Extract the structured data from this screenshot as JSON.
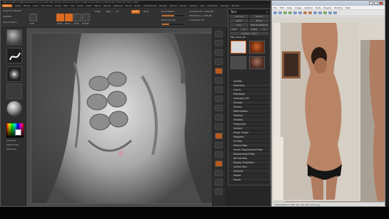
{
  "zbrush": {
    "title_bar": "ZBrush 4R6 [C:\\ZBrush\\Default Document]   ZBrush Document   Free Mem 8.8GB   Active Mem 1.1GB   Scratch Disk 48   Timer 0.006",
    "menu_items": [
      "Alpha",
      "Brush",
      "Color",
      "Document",
      "Draw",
      "Edit",
      "File",
      "Layer",
      "Light",
      "Macro",
      "Marker",
      "Material",
      "Movie",
      "Picker",
      "Preferences",
      "Render",
      "Stencil",
      "Stroke",
      "Texture",
      "Tool",
      "Transform",
      "Zplugin",
      "Zscript"
    ],
    "menu_highlight": "Menus",
    "tabs": {
      "edit": "Edit",
      "draw": "Draw",
      "move": "Move",
      "scale": "Scale",
      "rotate": "Rotate",
      "mrgb": "Mrgb",
      "rgb": "Rgb",
      "m": "M",
      "zadd": "Zadd",
      "zsub": "Zsub",
      "focal_shift": "Focal Shift 0",
      "draw_size": "Draw Size 64",
      "z_intensity": "Z Intensity 25",
      "active_points": "ActivePoints: 1.006 Mil",
      "total_points": "TotalPoints: 1.006 Mil"
    },
    "left_shelf": {
      "projection_master": "Projection Master",
      "lightbox": "LightBox",
      "quick_sketch": "Quick Sketch",
      "gradient": "Gradient",
      "switch_color": "SwitchColor",
      "alternate": "Alternate"
    },
    "right_shelf_labels": [
      "BPR",
      "SPix 3",
      "Scroll",
      "Zoom",
      "Actual",
      "AAHalf",
      "Persp",
      "Floor",
      "Local",
      "L.Sym",
      "Frame",
      "Move",
      "Scale",
      "Rotate",
      "PolyF",
      "Transp",
      "Solo",
      "Xpose"
    ]
  },
  "tool_panel": {
    "title": "Tool",
    "close": "×",
    "buttons_row1": [
      "Load Tool",
      "Save As"
    ],
    "buttons_row2": [
      "Import",
      "Export"
    ],
    "buttons_row3": [
      "Clone",
      "Make PolyMesh3D"
    ],
    "buttons_row4": [
      "GoZ",
      "All",
      "Visible",
      "R"
    ],
    "buttons_row5": [
      "Lightbox > Tools"
    ],
    "current_tool": "Man_Torso_02",
    "items": [
      "SubTool",
      "Geometry",
      "Layers",
      "FiberMesh",
      "Geometry HD",
      "Preview",
      "Surface",
      "Deformation",
      "Masking",
      "Visibility",
      "Polygroups",
      "Contact",
      "Morph Target",
      "Polypaint",
      "UV Map",
      "Texture Map",
      "Vector Displacement Map",
      "Displacement Map",
      "Normal Map",
      "Display Properties",
      "Unified Skin",
      "Initialize",
      "Import",
      "Export"
    ]
  },
  "viewer": {
    "menu_items": [
      "File",
      "Edit",
      "View",
      "Image",
      "Options",
      "Tools",
      "Plugins",
      "Window",
      "Help"
    ],
    "status": "1920x2880x24 BPP   38%   JPG   IMG_8412.jpg",
    "colors": {
      "title_active": "#b3c0d2",
      "close": "#c9483a"
    }
  },
  "colors": {
    "accent_orange": "#d96a1e",
    "zbrush_bg": "#2b2b2b",
    "canvas_bg": "#4a4a4a"
  }
}
